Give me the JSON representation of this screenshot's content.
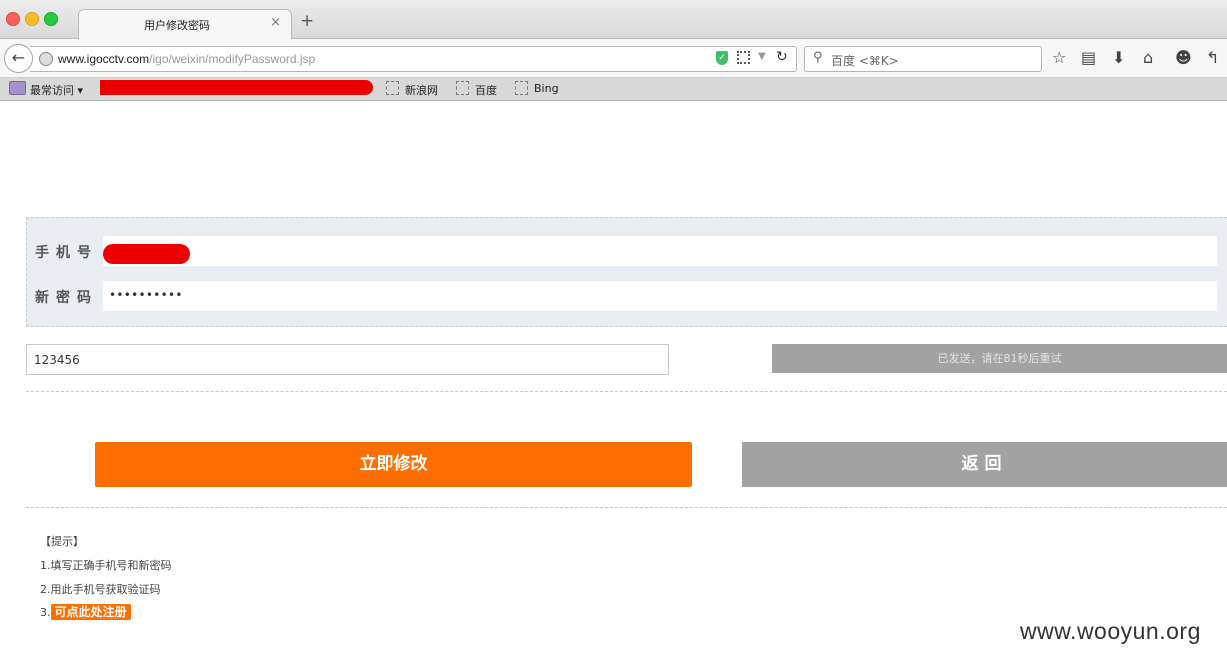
{
  "browser": {
    "tab_title": "用户修改密码",
    "tab_close": "×",
    "new_tab": "+",
    "url_host": "www.igocctv.com",
    "url_path": "/igo/weixin/modifyPassword.jsp",
    "search_placeholder": "百度 <⌘K>",
    "bookmarks": {
      "most_visited": "最常访问",
      "items": [
        "新浪网",
        "百度",
        "Bing"
      ]
    }
  },
  "form": {
    "phone_label": "手机号",
    "password_label": "新密码",
    "password_value": "••••••••••",
    "code_value": "123456",
    "sent_status": "已发送，请在81秒后重试",
    "submit_label": "立即修改",
    "back_label": "返回"
  },
  "tips": {
    "title": "【提示】",
    "line1": "1.填写正确手机号和新密码",
    "line2": "2.用此手机号获取验证码",
    "line3_prefix": "3.",
    "register_link": "可点此处注册"
  },
  "watermark": "www.wooyun.org",
  "colors": {
    "accent": "#ff6f00",
    "disabled": "#a2a2a2",
    "form_bg": "#e8edf2"
  }
}
